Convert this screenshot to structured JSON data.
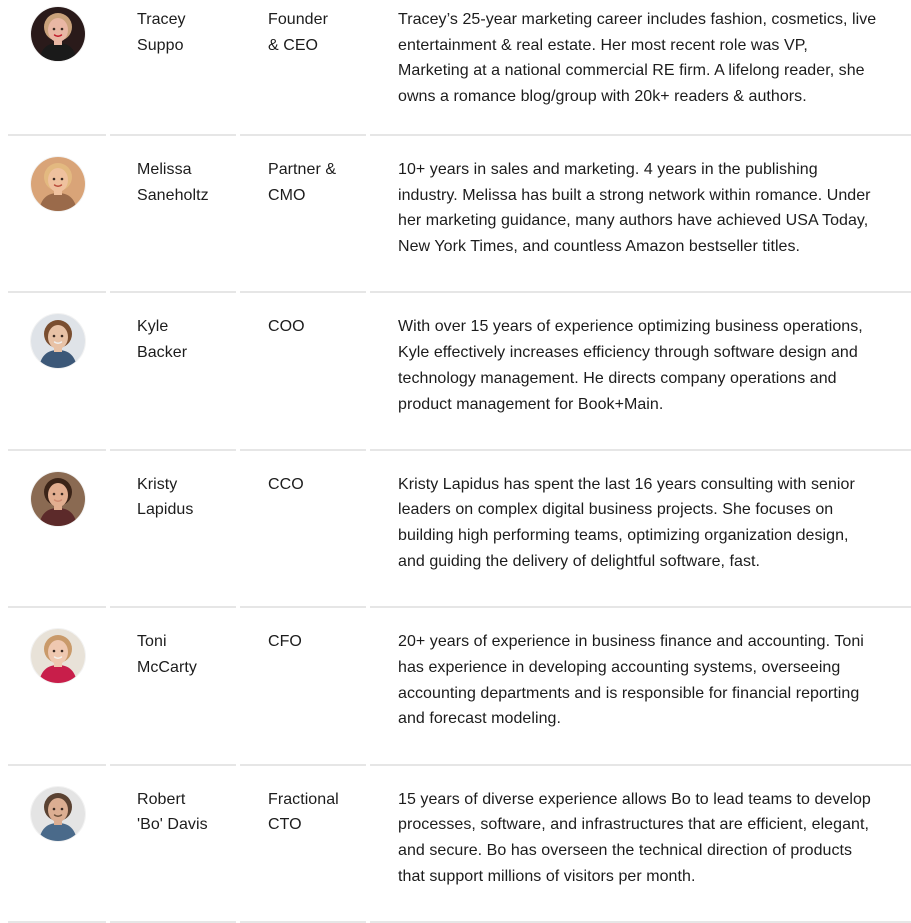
{
  "team": [
    {
      "name": "Tracey\nSuppo",
      "title": "Founder\n& CEO",
      "bio": "Tracey’s 25-year marketing career includes fashion, cosmetics, live\nentertainment & real estate. Her most recent role was VP,\nMarketing at a national commercial RE firm. A lifelong reader, she\nowns a romance blog/group with 20k+ readers & authors.",
      "avatar": {
        "bg": "#2a1a1a",
        "skin": "#e9b7a4",
        "hair": "#caa27b",
        "shirt": "#1a1a1a",
        "accent": "#c0182a"
      }
    },
    {
      "name": "Melissa\nSaneholtz",
      "title": "Partner &\nCMO",
      "bio": "10+ years in sales and marketing. 4 years in the publishing\nindustry. Melissa has built a strong network within romance. Under\nher marketing guidance, many authors have achieved USA Today,\nNew York Times, and countless Amazon bestseller titles.",
      "avatar": {
        "bg": "#d9a478",
        "skin": "#efc19e",
        "hair": "#e3b980",
        "shirt": "#9a6a4a",
        "accent": "#b84a3a"
      }
    },
    {
      "name": "Kyle\nBacker",
      "title": "COO",
      "bio": "With over 15 years of experience optimizing business operations,\nKyle effectively increases efficiency through software design and\ntechnology management. He directs company operations and\nproduct management for Book+Main.",
      "avatar": {
        "bg": "#dfe3e8",
        "skin": "#e8c2a6",
        "hair": "#7a4e30",
        "shirt": "#3c5878",
        "accent": "#f0f0f0"
      }
    },
    {
      "name": "Kristy\nLapidus",
      "title": "CCO",
      "bio": "Kristy Lapidus has spent the last 16 years consulting with senior\nleaders on complex digital business projects. She focuses on\nbuilding high performing teams, optimizing organization design,\nand guiding the delivery of delightful software, fast.",
      "avatar": {
        "bg": "#8a6a52",
        "skin": "#e2ae90",
        "hair": "#3b2418",
        "shirt": "#5c2a2a",
        "accent": "#d08a70"
      }
    },
    {
      "name": "Toni\nMcCarty",
      "title": "CFO",
      "bio": "20+ years of experience in business finance and accounting. Toni\nhas experience in developing accounting systems, overseeing\naccounting departments and is responsible for financial reporting\nand forecast modeling.",
      "avatar": {
        "bg": "#e8e2d8",
        "skin": "#efc8b0",
        "hair": "#c99a6a",
        "shirt": "#c81e4a",
        "accent": "#f4f1ec"
      }
    },
    {
      "name": "Robert\n'Bo' Davis",
      "title": "Fractional\nCTO",
      "bio": "15 years of diverse experience allows Bo to lead teams to develop\nprocesses, software, and infrastructures that are efficient, elegant,\nand secure. Bo has overseen the technical direction of products\nthat support millions of visitors per month.",
      "avatar": {
        "bg": "#e4e4e4",
        "skin": "#dcae92",
        "hair": "#5a4232",
        "shirt": "#4a6a8a",
        "accent": "#6b4f3a"
      }
    }
  ]
}
